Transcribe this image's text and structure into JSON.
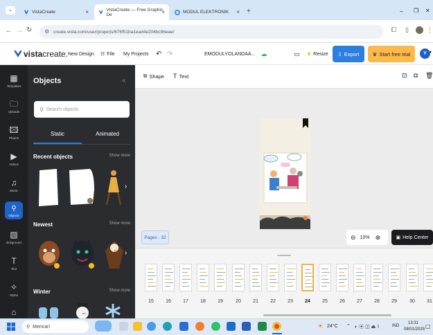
{
  "browser": {
    "tabs": [
      {
        "title": "VistaCreate",
        "active": false
      },
      {
        "title": "VistaCreate — Free Graphic De",
        "active": true
      },
      {
        "title": "MODUL ELEKTRONIK",
        "active": false
      }
    ],
    "new_tab": "+",
    "url": "create.vista.com/user/projects/676f51ba1ead4e204bc96eae/",
    "window_controls": {
      "minimize": "–",
      "restore": "❐",
      "close": "✕"
    }
  },
  "app": {
    "logo_bold": "vista",
    "logo_light": "create.",
    "menu": {
      "new_design": "New Design",
      "file": "File",
      "my_projects": "My Projects"
    },
    "project_name": "EMODULYOLANDAA...",
    "resize": "Resize",
    "export": "Export",
    "trial": "Start free trial",
    "avatar": "Y",
    "colors": {
      "accent": "#2e7de1",
      "trial": "#ffb84a",
      "dark": "#2b2c30"
    }
  },
  "rail": [
    {
      "label": "Templates",
      "icon": "templates-icon",
      "glyph": "▦"
    },
    {
      "label": "Uploads",
      "icon": "folder-icon",
      "glyph": "🗀"
    },
    {
      "label": "Photos",
      "icon": "photo-icon",
      "glyph": "🖾"
    },
    {
      "label": "Videos",
      "icon": "video-icon",
      "glyph": "▶"
    },
    {
      "label": "Music",
      "icon": "music-icon",
      "glyph": "♫"
    },
    {
      "label": "Objects",
      "icon": "objects-icon",
      "glyph": "⚲",
      "active": true
    },
    {
      "label": "Bckground",
      "icon": "background-icon",
      "glyph": "▨"
    },
    {
      "label": "Text",
      "icon": "text-icon",
      "glyph": "T"
    },
    {
      "label": "Styles",
      "icon": "styles-icon",
      "glyph": "✧"
    },
    {
      "label": "",
      "icon": "more-icon",
      "glyph": "⌂"
    }
  ],
  "panel": {
    "title": "Objects",
    "collapse": "«",
    "search_placeholder": "Search objects",
    "tabs": {
      "static": "Static",
      "animated": "Animated"
    },
    "sections": [
      {
        "title": "Recent objects",
        "more": "Show more"
      },
      {
        "title": "Newest",
        "more": "Show more"
      },
      {
        "title": "Winter",
        "more": "Show more"
      }
    ]
  },
  "toolbar": {
    "shape": "Shape",
    "text": "Text"
  },
  "canvas": {
    "pages_label": "Pages - 32",
    "zoom": "10%",
    "help": "Help Center"
  },
  "filmstrip": {
    "numbers": [
      "15",
      "16",
      "17",
      "18",
      "19",
      "20",
      "21",
      "22",
      "23",
      "24",
      "25",
      "26",
      "27",
      "28",
      "29",
      "30",
      "31"
    ],
    "selected": "24"
  },
  "taskbar": {
    "search_label": "Mencari",
    "weather": "24°C",
    "lang": "IND",
    "time": "13:31",
    "date": "08/01/2025"
  }
}
